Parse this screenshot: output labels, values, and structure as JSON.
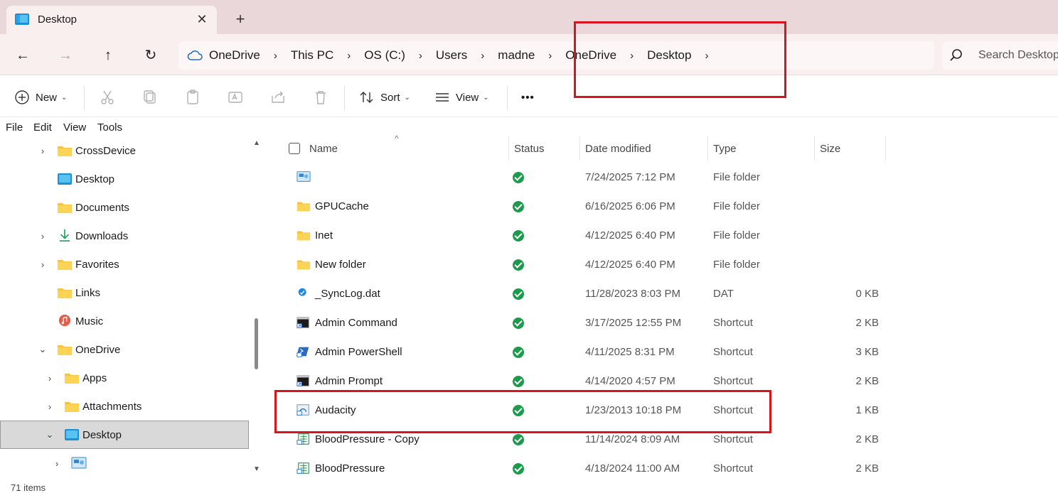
{
  "tab": {
    "title": "Desktop",
    "close_glyph": "✕",
    "new_tab_glyph": "+"
  },
  "nav": {
    "back": "←",
    "forward": "→",
    "up": "↑",
    "refresh": "↻"
  },
  "breadcrumb": {
    "parts": [
      "OneDrive",
      "This PC",
      "OS (C:)",
      "Users",
      "madne",
      "OneDrive",
      "Desktop"
    ],
    "separator": "›"
  },
  "search": {
    "placeholder": "Search Desktop"
  },
  "commands": {
    "new": "New",
    "sort": "Sort",
    "view": "View",
    "more": "•••",
    "dropdown": "⌄"
  },
  "menu": {
    "file": "File",
    "edit": "Edit",
    "view": "View",
    "tools": "Tools"
  },
  "tree": {
    "expand_glyph": "›",
    "collapse_glyph": "⌄",
    "items": [
      {
        "label": "CrossDevice",
        "icon": "folder-icon"
      },
      {
        "label": "Desktop",
        "icon": "desktop-folder-icon"
      },
      {
        "label": "Documents",
        "icon": "folder-icon"
      },
      {
        "label": "Downloads",
        "icon": "download-icon"
      },
      {
        "label": "Favorites",
        "icon": "folder-icon"
      },
      {
        "label": "Links",
        "icon": "folder-icon"
      },
      {
        "label": "Music",
        "icon": "music-icon"
      },
      {
        "label": "OneDrive",
        "icon": "folder-icon"
      },
      {
        "label": "Apps",
        "icon": "folder-icon"
      },
      {
        "label": "Attachments",
        "icon": "folder-icon"
      },
      {
        "label": "Desktop",
        "icon": "desktop-folder-icon"
      },
      {
        "label": "",
        "icon": "control-panel-icon"
      }
    ]
  },
  "columns": {
    "name": "Name",
    "status": "Status",
    "date": "Date modified",
    "type": "Type",
    "size": "Size",
    "sort_glyph": "^"
  },
  "files": [
    {
      "name": "",
      "date": "7/24/2025 7:12 PM",
      "type": "File folder",
      "size": "",
      "icon": "control-panel-icon"
    },
    {
      "name": "GPUCache",
      "date": "6/16/2025 6:06 PM",
      "type": "File folder",
      "size": "",
      "icon": "folder-icon"
    },
    {
      "name": "Inet",
      "date": "4/12/2025 6:40 PM",
      "type": "File folder",
      "size": "",
      "icon": "folder-icon"
    },
    {
      "name": "New folder",
      "date": "4/12/2025 6:40 PM",
      "type": "File folder",
      "size": "",
      "icon": "folder-icon"
    },
    {
      "name": "_SyncLog.dat",
      "date": "11/28/2023 8:03 PM",
      "type": "DAT",
      "size": "0 KB",
      "icon": "sync-file-icon"
    },
    {
      "name": "Admin Command",
      "date": "3/17/2025 12:55 PM",
      "type": "Shortcut",
      "size": "2 KB",
      "icon": "cmd-shortcut-icon"
    },
    {
      "name": "Admin PowerShell",
      "date": "4/11/2025 8:31 PM",
      "type": "Shortcut",
      "size": "3 KB",
      "icon": "powershell-shortcut-icon"
    },
    {
      "name": "Admin Prompt",
      "date": "4/14/2020 4:57 PM",
      "type": "Shortcut",
      "size": "2 KB",
      "icon": "cmd-shortcut-icon"
    },
    {
      "name": "Audacity",
      "date": "1/23/2013 10:18 PM",
      "type": "Shortcut",
      "size": "1 KB",
      "icon": "app-shortcut-icon"
    },
    {
      "name": "BloodPressure - Copy",
      "date": "11/14/2024 8:09 AM",
      "type": "Shortcut",
      "size": "2 KB",
      "icon": "excel-shortcut-icon"
    },
    {
      "name": "BloodPressure",
      "date": "4/18/2024 11:00 AM",
      "type": "Shortcut",
      "size": "2 KB",
      "icon": "excel-shortcut-icon"
    }
  ],
  "status_bar": {
    "items": "71 items"
  },
  "colors": {
    "accent": "#1e9a4c",
    "annotation": "#d9141c",
    "title_bg": "#ead7da",
    "selection": "#d9d9d9"
  }
}
